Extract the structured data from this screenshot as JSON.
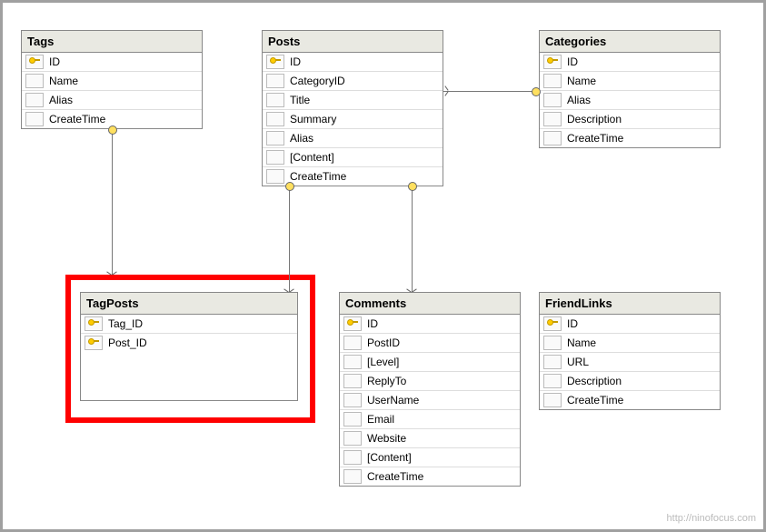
{
  "tables": {
    "tags": {
      "title": "Tags",
      "columns": [
        {
          "name": "ID",
          "pk": true
        },
        {
          "name": "Name",
          "pk": false
        },
        {
          "name": "Alias",
          "pk": false
        },
        {
          "name": "CreateTime",
          "pk": false
        }
      ]
    },
    "posts": {
      "title": "Posts",
      "columns": [
        {
          "name": "ID",
          "pk": true
        },
        {
          "name": "CategoryID",
          "pk": false
        },
        {
          "name": "Title",
          "pk": false
        },
        {
          "name": "Summary",
          "pk": false
        },
        {
          "name": "Alias",
          "pk": false
        },
        {
          "name": "[Content]",
          "pk": false
        },
        {
          "name": "CreateTime",
          "pk": false
        }
      ]
    },
    "categories": {
      "title": "Categories",
      "columns": [
        {
          "name": "ID",
          "pk": true
        },
        {
          "name": "Name",
          "pk": false
        },
        {
          "name": "Alias",
          "pk": false
        },
        {
          "name": "Description",
          "pk": false
        },
        {
          "name": "CreateTime",
          "pk": false
        }
      ]
    },
    "tagposts": {
      "title": "TagPosts",
      "columns": [
        {
          "name": "Tag_ID",
          "pk": true
        },
        {
          "name": "Post_ID",
          "pk": true
        }
      ]
    },
    "comments": {
      "title": "Comments",
      "columns": [
        {
          "name": "ID",
          "pk": true
        },
        {
          "name": "PostID",
          "pk": false
        },
        {
          "name": "[Level]",
          "pk": false
        },
        {
          "name": "ReplyTo",
          "pk": false
        },
        {
          "name": "UserName",
          "pk": false
        },
        {
          "name": "Email",
          "pk": false
        },
        {
          "name": "Website",
          "pk": false
        },
        {
          "name": "[Content]",
          "pk": false
        },
        {
          "name": "CreateTime",
          "pk": false
        }
      ]
    },
    "friendlinks": {
      "title": "FriendLinks",
      "columns": [
        {
          "name": "ID",
          "pk": true
        },
        {
          "name": "Name",
          "pk": false
        },
        {
          "name": "URL",
          "pk": false
        },
        {
          "name": "Description",
          "pk": false
        },
        {
          "name": "CreateTime",
          "pk": false
        }
      ]
    }
  },
  "watermark": "http://ninofocus.com"
}
